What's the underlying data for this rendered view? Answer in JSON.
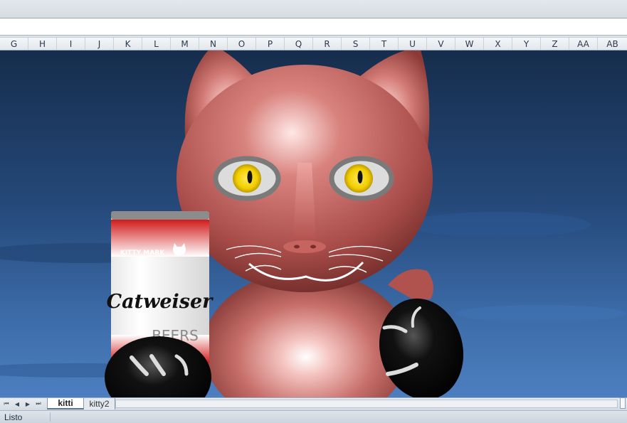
{
  "columns": [
    "G",
    "H",
    "I",
    "J",
    "K",
    "L",
    "M",
    "N",
    "O",
    "P",
    "Q",
    "R",
    "S",
    "T",
    "U",
    "V",
    "W",
    "X",
    "Y",
    "Z",
    "AA",
    "AB"
  ],
  "drawing": {
    "can": {
      "brand_top": "KITTY MARK",
      "brand_name": "Catweiser",
      "brand_sub": "BEERS"
    },
    "colors": {
      "cat_body": "#c46a66",
      "eye_iris": "#f2d000",
      "paw": "#000000",
      "can_red": "#d11a1a",
      "sky_top": "#162d4c"
    }
  },
  "sheet_tabs": [
    {
      "label": "kitti",
      "active": true
    },
    {
      "label": "kitty2",
      "active": false
    }
  ],
  "status": {
    "text": "Listo"
  },
  "icons": [
    "first-sheet-icon",
    "prev-sheet-icon",
    "next-sheet-icon",
    "last-sheet-icon",
    "cat-head-icon"
  ]
}
